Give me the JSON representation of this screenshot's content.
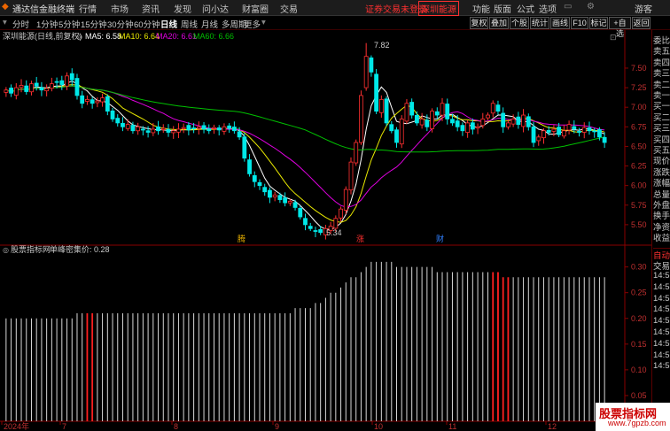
{
  "app": {
    "title": "通达信金融终端",
    "menus": [
      "行情",
      "市场",
      "资讯",
      "发现",
      "问小达",
      "财富圈",
      "交易"
    ],
    "notice": "证券交易未登录",
    "stock_tab": "深圳能源",
    "right_menus": [
      "功能",
      "版面",
      "公式",
      "选项"
    ],
    "user": "游客"
  },
  "toolbar": {
    "periods": [
      "分时",
      "1分钟",
      "5分钟",
      "15分钟",
      "30分钟",
      "60分钟",
      "日线",
      "周线",
      "月线",
      "多周期",
      "更多"
    ],
    "active_period": "日线",
    "right_buttons": [
      "复权",
      "叠加",
      "个股",
      "统计",
      "画线",
      "F10",
      "标记",
      "+自选",
      "返回"
    ]
  },
  "price_chart": {
    "title": "深圳能源(日线,前复权)",
    "ma": [
      {
        "label": "MA5: 6.58",
        "color": "#ffffff"
      },
      {
        "label": "MA10: 6.64",
        "color": "#e8e800"
      },
      {
        "label": "MA20: 6.61",
        "color": "#e000e0"
      },
      {
        "label": "MA60: 6.66",
        "color": "#00c000"
      }
    ],
    "high_label": "7.82",
    "low_label": "5.34",
    "y_ticks": [
      "7.50",
      "7.25",
      "7.00",
      "6.75",
      "6.50",
      "6.25",
      "6.00",
      "5.75",
      "5.50"
    ],
    "markers": [
      "腾",
      "涨",
      "财"
    ]
  },
  "indicator": {
    "source": "股票指标网",
    "name": "单峰密集价: 0.28",
    "y_ticks": [
      "0.30",
      "0.25",
      "0.20",
      "0.15",
      "0.10",
      "0.05"
    ]
  },
  "x_axis": {
    "labels": [
      "2024年",
      "7",
      "8",
      "9",
      "10",
      "11",
      "12"
    ]
  },
  "sidebar": {
    "items": [
      "委比",
      "卖五",
      "卖四",
      "卖三",
      "卖二",
      "卖一",
      "买一",
      "买二",
      "买三",
      "买四",
      "买五",
      "现价",
      "涨跌",
      "涨幅",
      "总量",
      "外盘",
      "换手",
      "净资",
      "收益"
    ],
    "bottom_tab": "自动",
    "bottom_label": "交易",
    "bottom_times": [
      "14:56",
      "14:56",
      "14:56",
      "14:56",
      "14:56",
      "14:56",
      "14:56",
      "14:56",
      "14:56"
    ]
  },
  "watermark": {
    "line1": "股票指标网",
    "line2": "www.7gpzb.com"
  },
  "chart_data": {
    "type": "candlestick",
    "ylim": [
      5.25,
      7.85
    ],
    "closes": [
      7.22,
      7.18,
      7.25,
      7.28,
      7.2,
      7.3,
      7.27,
      7.22,
      7.24,
      7.3,
      7.32,
      7.29,
      7.4,
      7.35,
      7.15,
      7.05,
      7.1,
      7.05,
      7.08,
      7.12,
      6.95,
      6.85,
      6.8,
      6.75,
      6.78,
      6.7,
      6.75,
      6.72,
      6.68,
      6.72,
      6.7,
      6.73,
      6.68,
      6.7,
      6.72,
      6.74,
      6.71,
      6.73,
      6.75,
      6.72,
      6.7,
      6.74,
      6.71,
      6.75,
      6.73,
      6.7,
      6.62,
      6.35,
      6.15,
      6.05,
      6.0,
      5.92,
      5.85,
      5.88,
      5.82,
      5.78,
      5.8,
      5.72,
      5.6,
      5.5,
      5.45,
      5.42,
      5.4,
      5.45,
      5.48,
      5.58,
      5.7,
      5.95,
      6.3,
      6.55,
      7.15,
      7.65,
      7.45,
      6.95,
      7.1,
      6.8,
      6.7,
      6.55,
      6.85,
      7.05,
      6.9,
      6.8,
      6.85,
      6.75,
      6.95,
      6.9,
      7.05,
      6.85,
      6.8,
      6.75,
      6.7,
      6.8,
      6.72,
      6.75,
      6.85,
      6.9,
      7.05,
      6.95,
      6.75,
      6.8,
      6.85,
      6.78,
      6.9,
      6.75,
      6.55,
      6.62,
      6.7,
      6.68,
      6.72,
      6.65,
      6.7,
      6.78,
      6.72,
      6.68,
      6.74,
      6.7,
      6.69,
      6.62,
      6.55
    ],
    "indicator_values": [
      0.2,
      0.2,
      0.2,
      0.2,
      0.2,
      0.2,
      0.2,
      0.2,
      0.2,
      0.2,
      0.2,
      0.2,
      0.2,
      0.2,
      0.21,
      0.21,
      0.21,
      0.21,
      0.21,
      0.21,
      0.21,
      0.21,
      0.21,
      0.21,
      0.21,
      0.21,
      0.21,
      0.21,
      0.21,
      0.21,
      0.21,
      0.21,
      0.21,
      0.21,
      0.21,
      0.21,
      0.21,
      0.21,
      0.21,
      0.21,
      0.21,
      0.21,
      0.21,
      0.21,
      0.21,
      0.21,
      0.21,
      0.21,
      0.21,
      0.21,
      0.21,
      0.21,
      0.21,
      0.21,
      0.21,
      0.21,
      0.21,
      0.22,
      0.22,
      0.22,
      0.22,
      0.23,
      0.23,
      0.24,
      0.25,
      0.25,
      0.26,
      0.27,
      0.28,
      0.28,
      0.29,
      0.3,
      0.31,
      0.31,
      0.31,
      0.31,
      0.31,
      0.3,
      0.3,
      0.3,
      0.3,
      0.3,
      0.3,
      0.3,
      0.3,
      0.29,
      0.29,
      0.29,
      0.29,
      0.29,
      0.29,
      0.29,
      0.29,
      0.29,
      0.29,
      0.29,
      0.29,
      0.29,
      0.28,
      0.28,
      0.28,
      0.28,
      0.28,
      0.28,
      0.28,
      0.28,
      0.28,
      0.28,
      0.28,
      0.28,
      0.28,
      0.28,
      0.28,
      0.28,
      0.28,
      0.28,
      0.28,
      0.28,
      0.28
    ],
    "red_bars": [
      16,
      17,
      96,
      97,
      98,
      99
    ],
    "indicator_ylim": [
      0,
      0.32
    ]
  }
}
